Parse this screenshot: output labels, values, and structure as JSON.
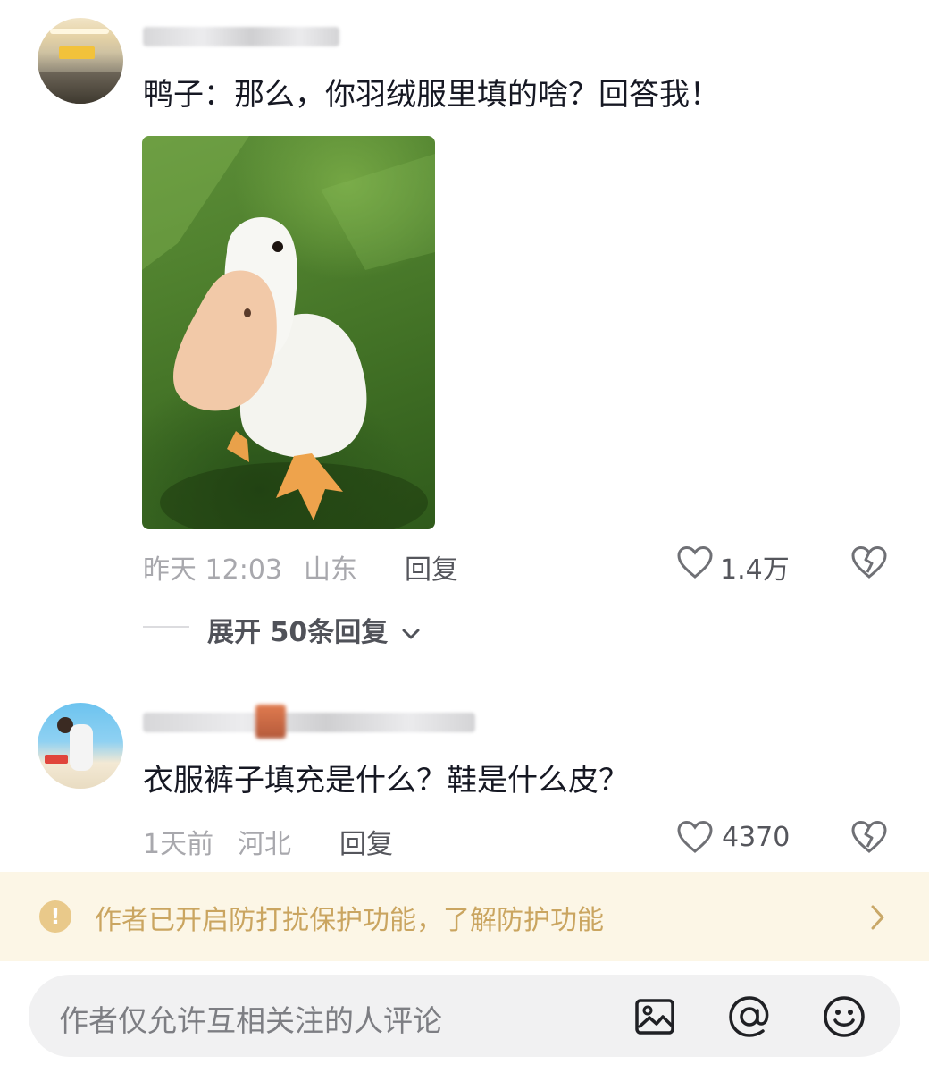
{
  "comments": [
    {
      "text": "鸭子：那么，你羽绒服里填的啥？回答我！",
      "time": "昨天 12:03",
      "location": "山东",
      "reply_label": "回复",
      "likes": "1.4万",
      "expand_label": "展开 50条回复"
    },
    {
      "text": "衣服裤子填充是什么？鞋是什么皮？",
      "time": "1天前",
      "location": "河北",
      "reply_label": "回复",
      "likes": "4370"
    }
  ],
  "notice": {
    "icon": "!",
    "text": "作者已开启防打扰保护功能，了解防护功能"
  },
  "input": {
    "placeholder": "作者仅允许互相关注的人评论"
  }
}
